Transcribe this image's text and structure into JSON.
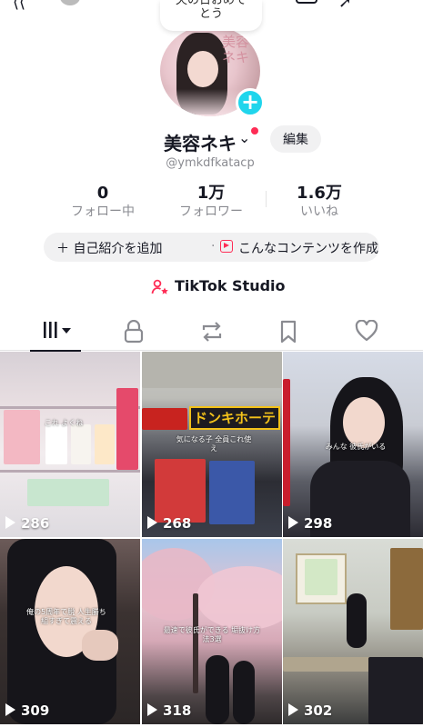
{
  "note": {
    "line1": "夫の日おめで",
    "line2": "とう"
  },
  "avatar": {
    "overlay_text": "美容ネキ"
  },
  "profile": {
    "display_name": "美容ネキ",
    "username": "@ymkdfkatacp",
    "edit_label": "編集"
  },
  "stats": [
    {
      "value": "0",
      "label": "フォロー中"
    },
    {
      "value": "1万",
      "label": "フォロワー"
    },
    {
      "value": "1.6万",
      "label": "いいね"
    }
  ],
  "bio_bar": {
    "add_bio": "＋ 自己紹介を追加",
    "separator": "·",
    "suggestion": "こんなコンテンツを作成…"
  },
  "studio": {
    "label": "TikTok Studio"
  },
  "tabs": [
    {
      "icon": "grid-icon",
      "active": true
    },
    {
      "icon": "lock-icon"
    },
    {
      "icon": "repost-icon"
    },
    {
      "icon": "bookmark-icon"
    },
    {
      "icon": "heart-icon"
    }
  ],
  "videos": [
    {
      "views": "286",
      "caption": "これ よくね"
    },
    {
      "views": "268",
      "caption": "ドンキホーテ",
      "caption2": "気になる子 全員これ使え"
    },
    {
      "views": "298",
      "caption": "みんな 彼氏がいる"
    },
    {
      "views": "309",
      "caption": "俺の5周年で脱 人生勝ち組すぎて震える"
    },
    {
      "views": "318",
      "caption": "最速で彼氏ができる 垢抜け方法3選"
    },
    {
      "views": "302",
      "caption": ""
    }
  ],
  "colors": {
    "accent": "#fe2c55",
    "plus": "#20d5ec",
    "muted": "#8a8b91"
  }
}
